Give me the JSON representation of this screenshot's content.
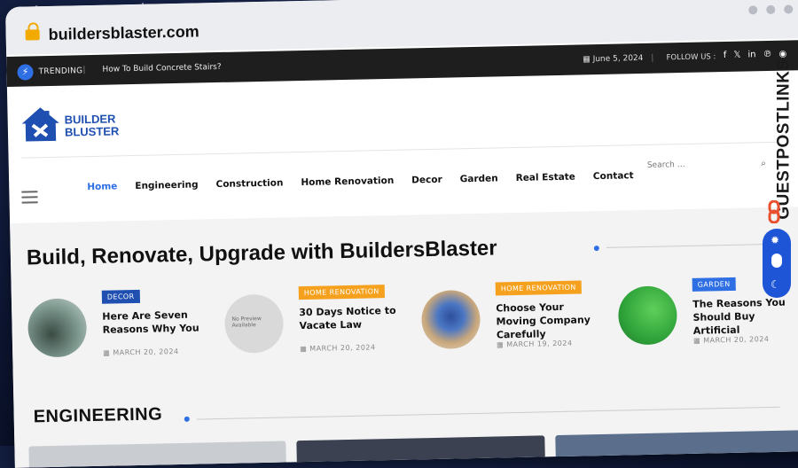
{
  "browser": {
    "url": "buildersblaster.com"
  },
  "topbar": {
    "trending_label": "TRENDING",
    "trending_title": "How To Build Concrete Stairs?",
    "date": "June 5, 2024",
    "follow_label": "FOLLOW US :",
    "social_icons": [
      "facebook-icon",
      "x-icon",
      "linkedin-icon",
      "pinterest-icon",
      "reddit-icon"
    ]
  },
  "logo": {
    "line1": "BUILDER",
    "line2": "BLUSTER"
  },
  "nav": {
    "items": [
      "Home",
      "Engineering",
      "Construction",
      "Home Renovation",
      "Decor",
      "Garden",
      "Real Estate",
      "Contact"
    ],
    "active": "Home",
    "search_placeholder": "Search …"
  },
  "hero": {
    "headline": "Build, Renovate, Upgrade with BuildersBlaster"
  },
  "cards": [
    {
      "tag": "DECOR",
      "tag_color": "#1f4fb0",
      "title": "Here Are Seven Reasons Why You",
      "date": "MARCH 20, 2024"
    },
    {
      "tag": "HOME RENOVATION",
      "tag_color": "#f5a11e",
      "title": "30 Days Notice to Vacate Law",
      "date": "MARCH 20, 2024",
      "thumb_text": "No Preview Available"
    },
    {
      "tag": "HOME RENOVATION",
      "tag_color": "#f5a11e",
      "title": "Choose Your Moving Company Carefully",
      "date": "MARCH 19, 2024"
    },
    {
      "tag": "GARDEN",
      "tag_color": "#2f6fe4",
      "title": "The Reasons You Should Buy Artificial",
      "date": "MARCH 20, 2024"
    }
  ],
  "section": {
    "title": "ENGINEERING"
  },
  "watermark": {
    "text": "GUESTPOSTLINKS"
  },
  "colors": {
    "accent": "#2f6fe4",
    "topbar_bg": "#1e1e1e",
    "logo_blue": "#1f4fb0"
  }
}
